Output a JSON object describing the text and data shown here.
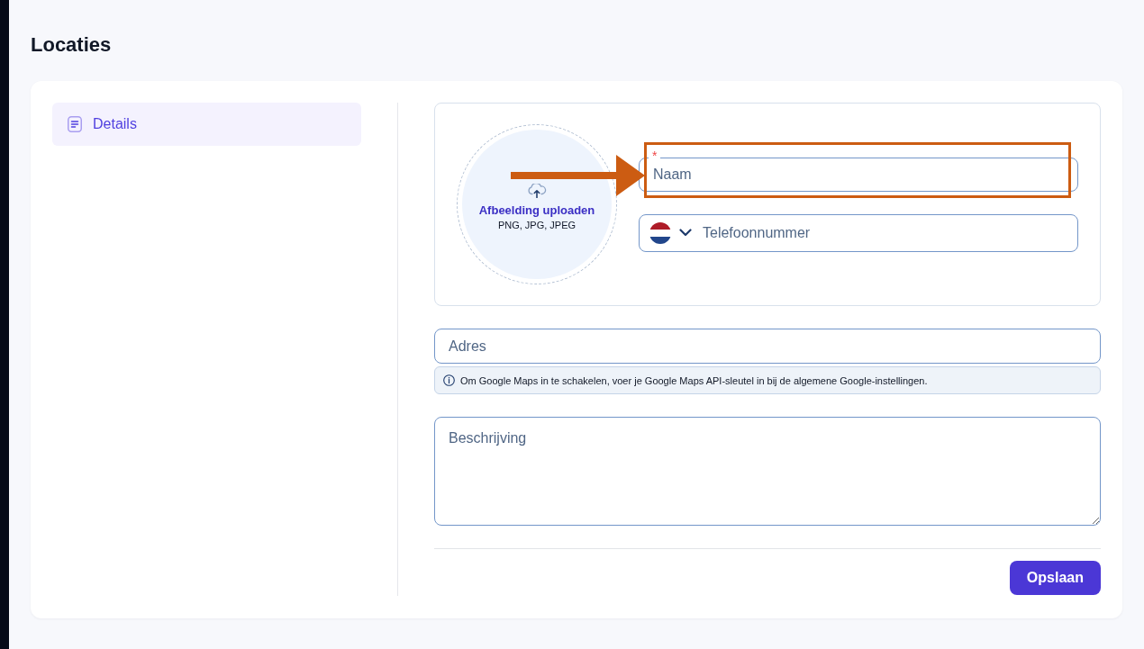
{
  "page": {
    "title": "Locaties"
  },
  "sidebar": {
    "items": [
      {
        "label": "Details",
        "selected": true
      }
    ]
  },
  "upload": {
    "title": "Afbeelding uploaden",
    "formats": "PNG, JPG, JPEG"
  },
  "name_field": {
    "required_mark": "*",
    "placeholder": "Naam",
    "highlighted": true
  },
  "phone_field": {
    "placeholder": "Telefoonnummer"
  },
  "address_field": {
    "placeholder": "Adres"
  },
  "address_note": "Om Google Maps in te schakelen, voer je Google Maps API-sleutel in bij de algemene Google-instellingen.",
  "description_field": {
    "placeholder": "Beschrijving"
  },
  "buttons": [
    {
      "label": "Opslaan"
    }
  ]
}
